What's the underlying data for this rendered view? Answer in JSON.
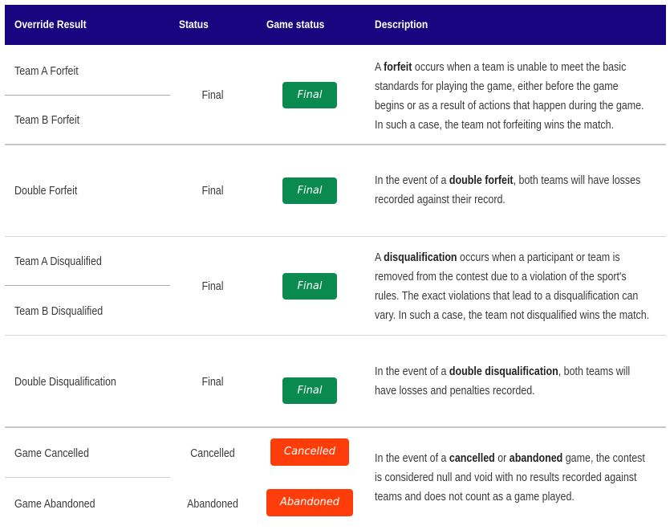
{
  "headers": {
    "override_result": "Override Result",
    "status": "Status",
    "game_status": "Game status",
    "description": "Description"
  },
  "rows": {
    "forfeit": {
      "result_a": "Team A Forfeit",
      "result_b": "Team B Forfeit",
      "status": "Final",
      "badge": "Final",
      "desc": [
        "A ",
        "forfeit",
        " occurs when a team is unable to meet the basic",
        "standards for playing the game, either before the game",
        "begins or as a result of actions that happen during the game.",
        "In such a case, the team not forfeiting wins the match."
      ]
    },
    "double_forfeit": {
      "result": "Double Forfeit",
      "status": "Final",
      "badge": "Final",
      "desc": [
        "In the event of a ",
        "double forfeit",
        ", both teams will have losses",
        "recorded against their record."
      ]
    },
    "disqualified": {
      "result_a": "Team A Disqualified",
      "result_b": "Team B Disqualified",
      "status": "Final",
      "badge": "Final",
      "desc": [
        "A ",
        "disqualification",
        " occurs when a participant or team is",
        "removed from the contest due to a violation of the sport's",
        "rules. The exact violations that lead to a disqualification can",
        "vary. In such a case, the team not disqualified wins the match."
      ]
    },
    "double_disqualification": {
      "result": "Double Disqualification",
      "status": "Final",
      "badge": "Final",
      "desc": [
        "In the event of a ",
        "double disqualification",
        ", both teams will",
        "have losses and penalties recorded."
      ]
    },
    "cancelled": {
      "result_a": "Game Cancelled",
      "result_b": "Game Abandoned",
      "status_a": "Cancelled",
      "status_b": "Abandoned",
      "badge_a": "Cancelled",
      "badge_b": "Abandoned",
      "desc": [
        "In the event of a ",
        "cancelled",
        " or ",
        "abandoned",
        " game, the contest",
        "is considered null and void with no results recorded against",
        "teams and does not count as a game played."
      ]
    }
  },
  "colors": {
    "header_bg": "#1a0580",
    "final_badge": "#0a8a4e",
    "cancel_badge": "#ff3d0a"
  }
}
